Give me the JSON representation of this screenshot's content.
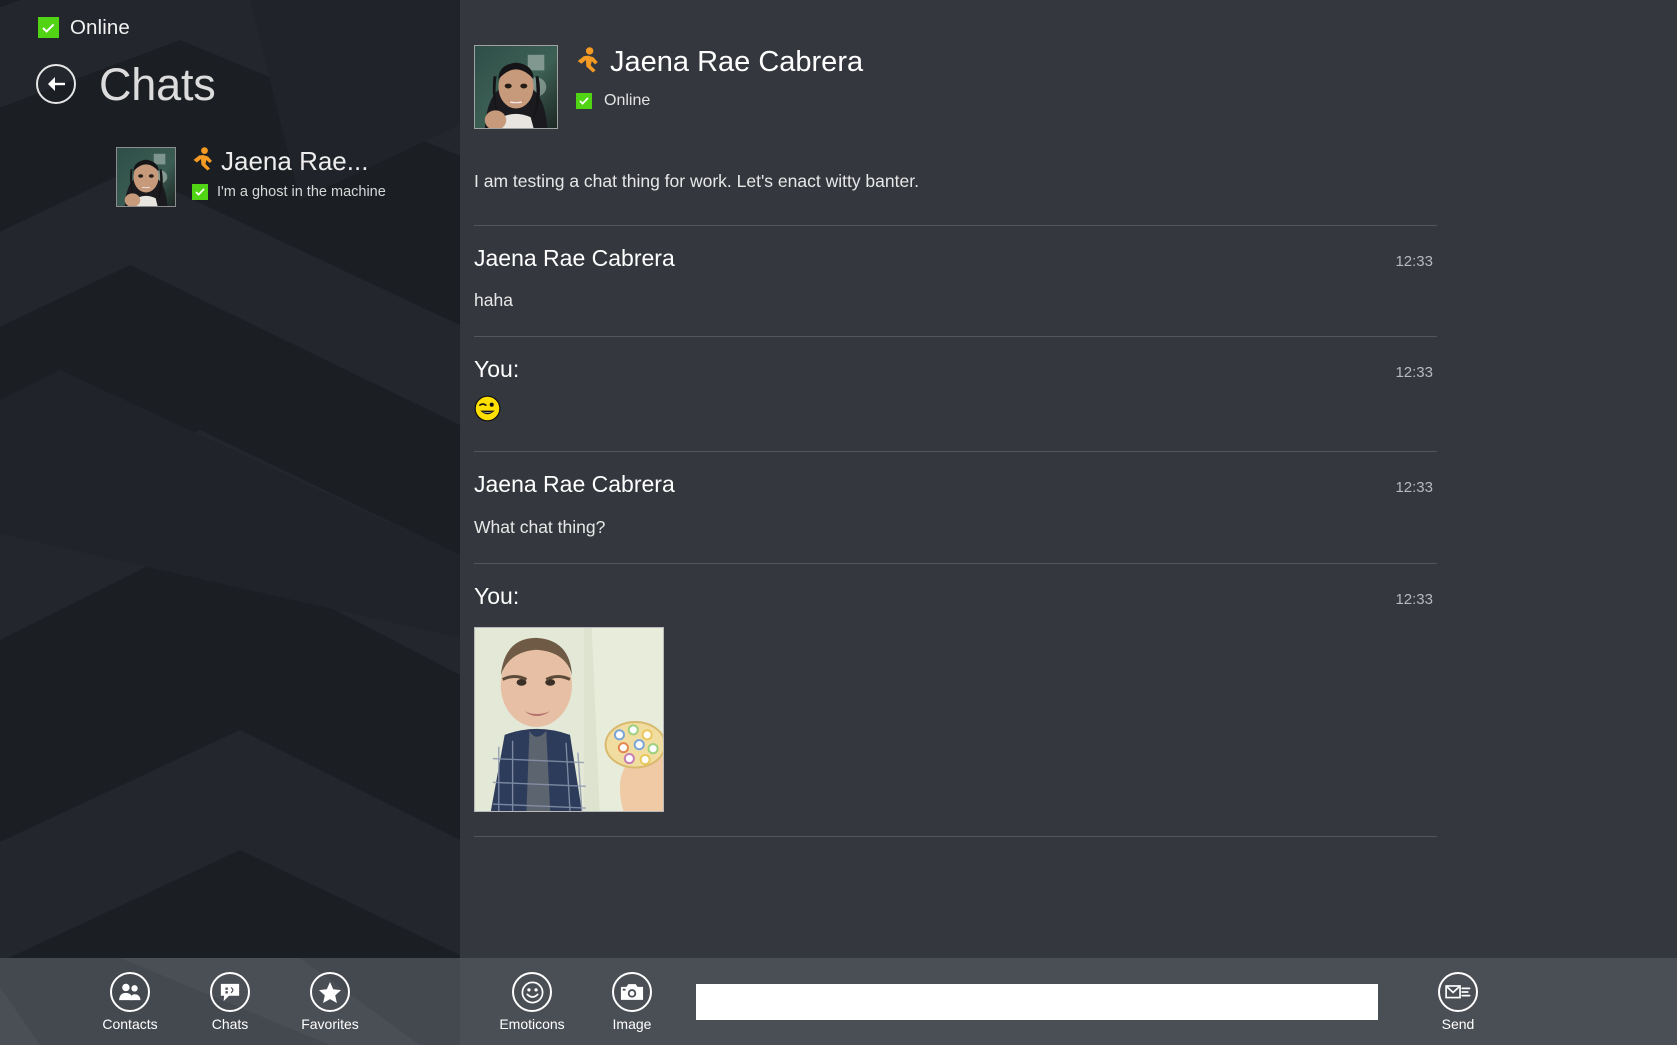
{
  "left": {
    "status": {
      "text": "Online",
      "badge_color": "#50d413",
      "icon": "check-badge-icon"
    },
    "back_icon": "back-arrow-icon",
    "title": "Chats",
    "chat_list": [
      {
        "name": "Jaena Rae...",
        "presence_icon": "im-running-man-icon",
        "status_message": "I'm a ghost in the machine",
        "avatar": "contact-avatar-thumbnail"
      }
    ]
  },
  "conversation": {
    "contact_name": "Jaena Rae Cabrera",
    "presence_icon": "im-running-man-icon",
    "presence_text": "Online",
    "avatar": "contact-avatar-large",
    "intro_message": "I am testing a chat thing for work. Let's enact witty banter.",
    "messages": [
      {
        "sender": "Jaena Rae Cabrera",
        "time": "12:33",
        "text": "haha",
        "type": "text"
      },
      {
        "sender": "You:",
        "time": "12:33",
        "text": "",
        "type": "emoticon",
        "emoticon": "winking-smiley-icon"
      },
      {
        "sender": "Jaena Rae Cabrera",
        "time": "12:33",
        "text": "What chat thing?",
        "type": "text"
      },
      {
        "sender": "You:",
        "time": "12:33",
        "text": "",
        "type": "image",
        "image": "sent-photo-attachment"
      }
    ]
  },
  "appbar": {
    "left_commands": [
      {
        "label": "Contacts",
        "icon": "contacts-icon"
      },
      {
        "label": "Chats",
        "icon": "chats-bubble-icon"
      },
      {
        "label": "Favorites",
        "icon": "star-icon"
      }
    ],
    "right_commands": [
      {
        "label": "Emoticons",
        "icon": "smiley-icon"
      },
      {
        "label": "Image",
        "icon": "camera-icon"
      }
    ],
    "send": {
      "label": "Send",
      "icon": "send-envelope-icon"
    },
    "compose": {
      "value": "",
      "placeholder": ""
    }
  },
  "colors": {
    "left_bg": "#1b1e23",
    "right_bg": "#34373d",
    "appbar_bg": "#4a4e55",
    "accent_green": "#50d413",
    "accent_orange": "#f59a23",
    "divider": "#53565b"
  }
}
